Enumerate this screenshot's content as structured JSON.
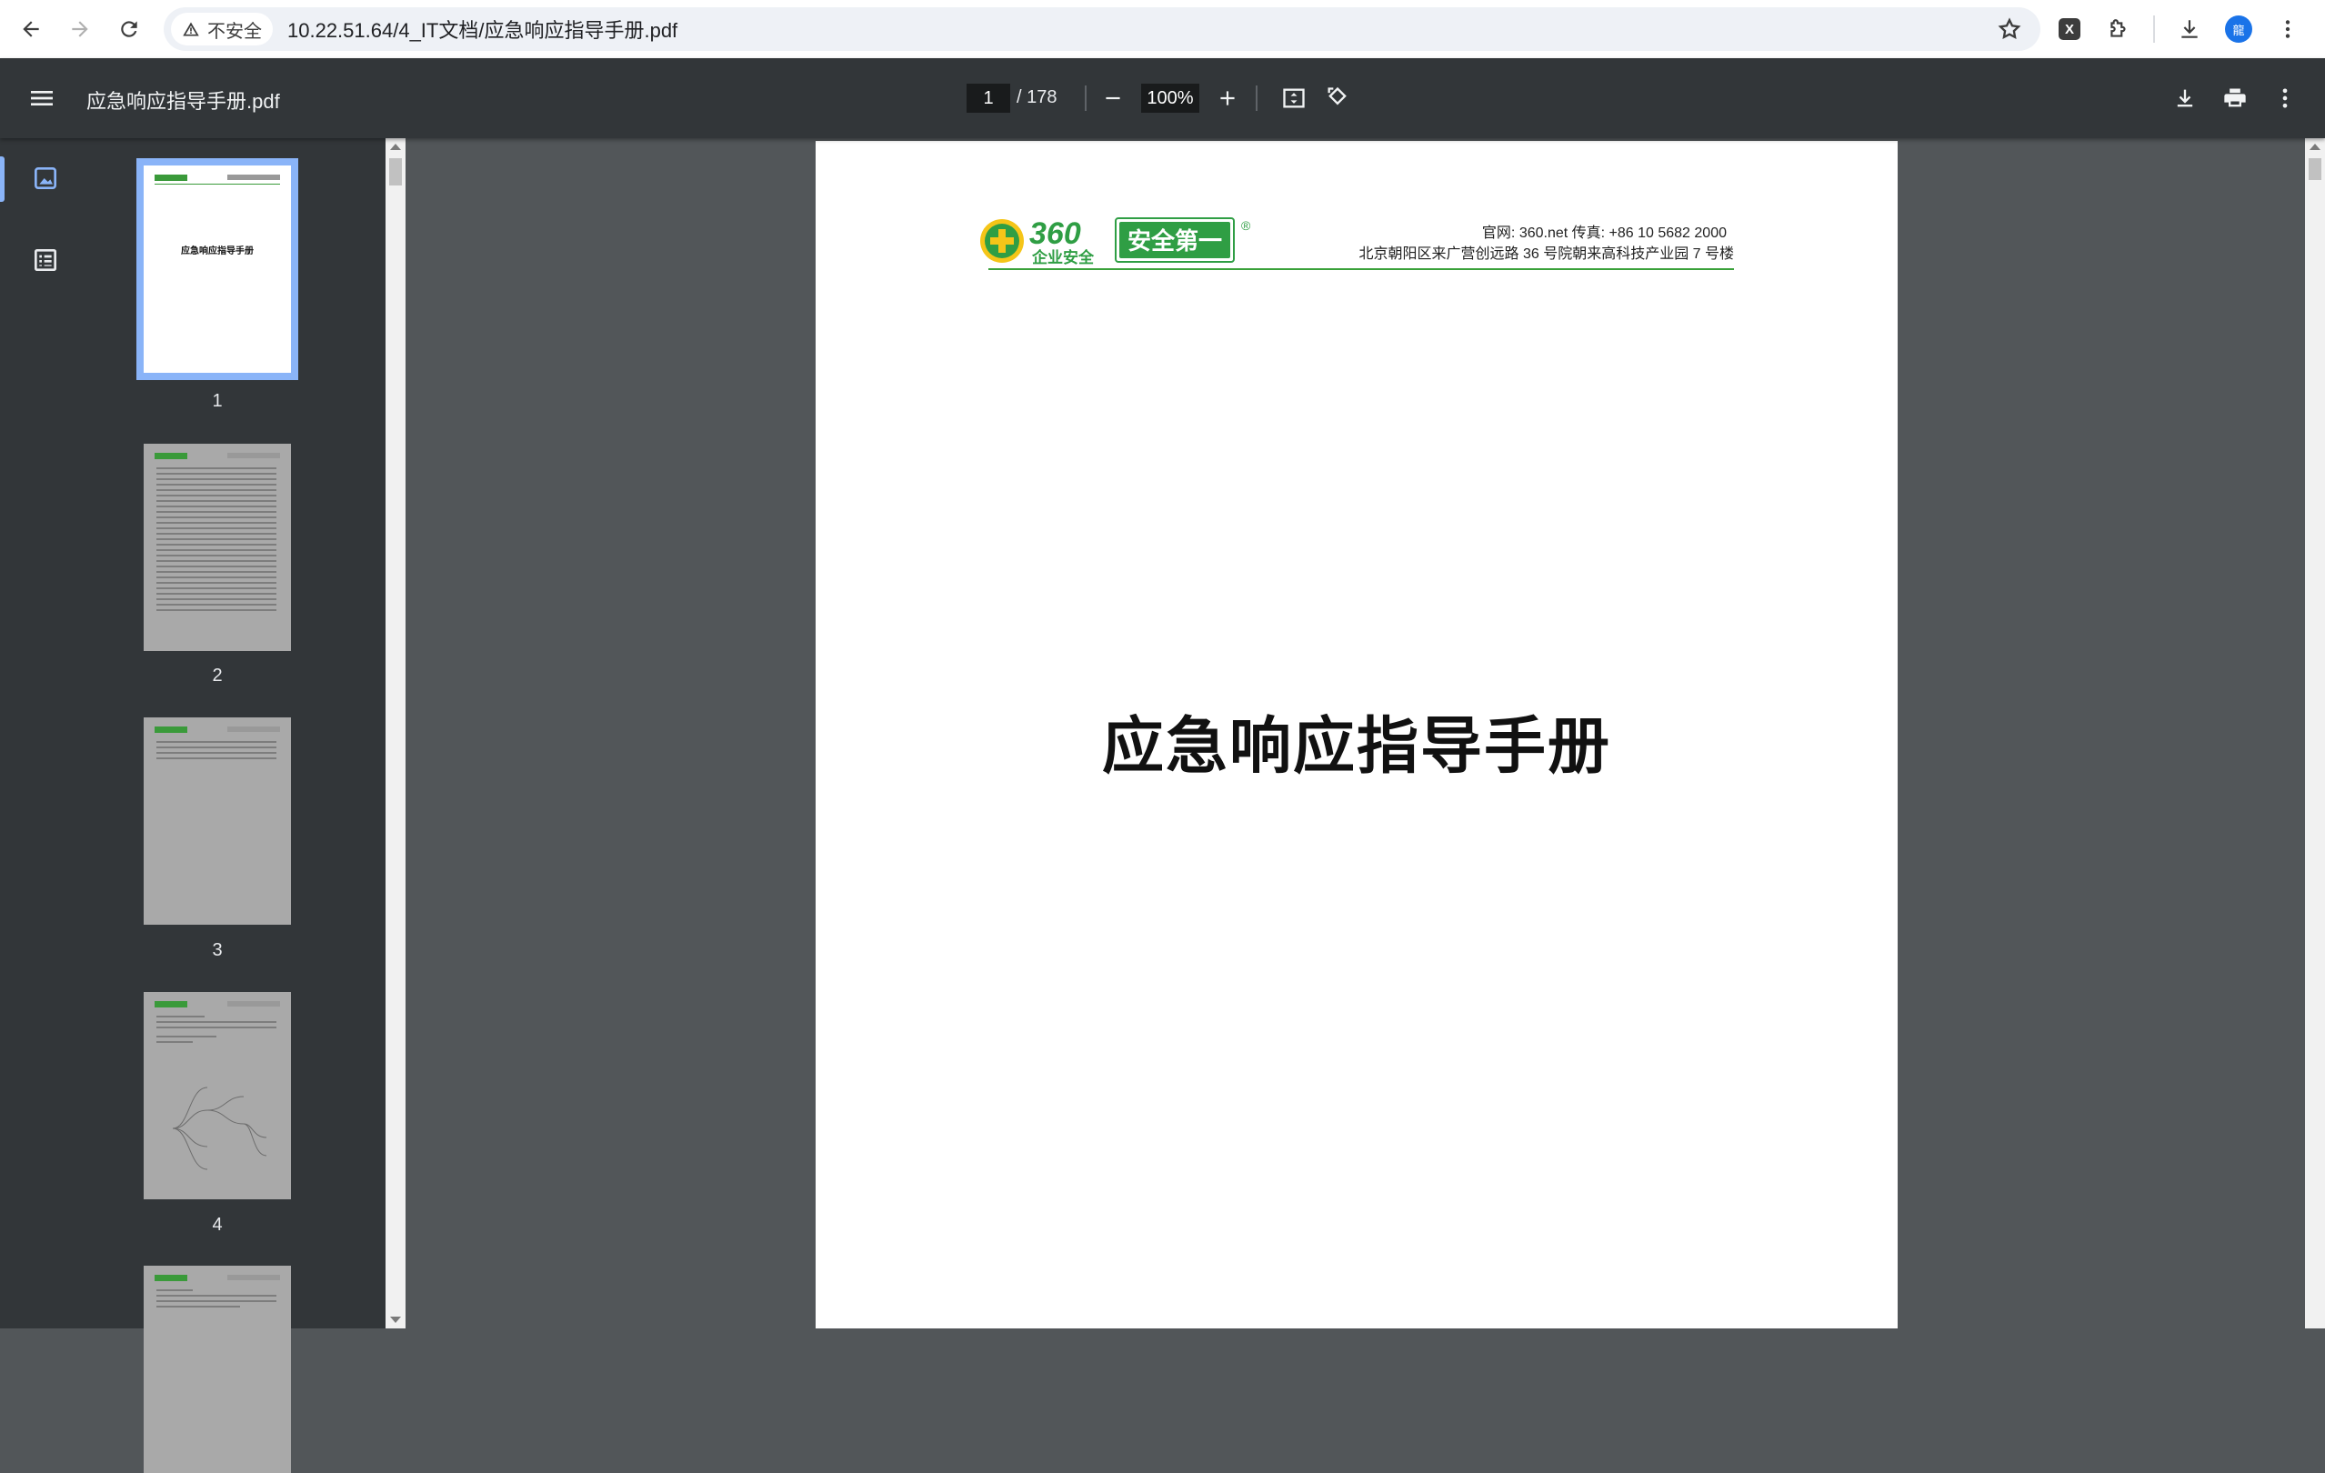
{
  "browser": {
    "security_label": "不安全",
    "url": "10.22.51.64/4_IT文档/应急响应指导手册.pdf",
    "avatar_text": "龍",
    "extension_badge": "X"
  },
  "pdf_toolbar": {
    "title": "应急响应指导手册.pdf",
    "current_page": "1",
    "total_pages": "/ 178",
    "zoom": "100%"
  },
  "thumbnails": [
    {
      "number": "1",
      "title": "应急响应指导手册"
    },
    {
      "number": "2"
    },
    {
      "number": "3"
    },
    {
      "number": "4"
    }
  ],
  "page": {
    "logo_number": "360",
    "logo_sub": "企业安全",
    "logo_badge": "安全第一",
    "registered": "®",
    "header_line1": "官网: 360.net    传真: +86 10 5682 2000",
    "header_line2": "北京朝阳区来广营创远路 36 号院朝来高科技产业园 7 号楼",
    "title": "应急响应指导手册"
  },
  "colors": {
    "pdf_toolbar_bg": "#323639",
    "viewer_bg": "#525659",
    "accent_blue": "#8ab4f8",
    "brand_green": "#3aa13a"
  }
}
